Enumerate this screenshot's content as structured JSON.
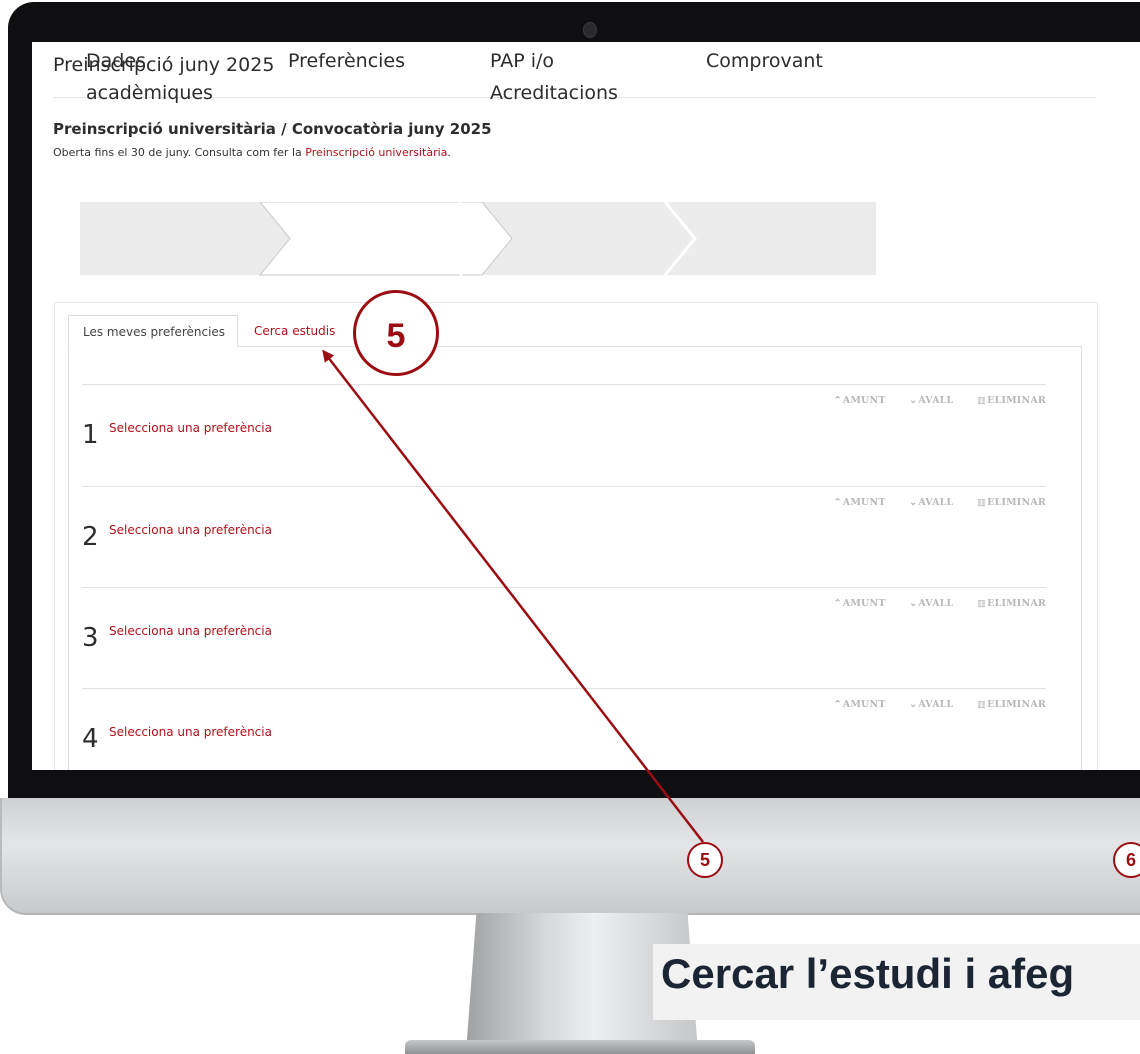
{
  "page": {
    "title": "Preinscripció juny 2025",
    "breadcrumb": "Preinscripció universitària / Convocatòria juny 2025",
    "note_prefix": "Oberta fins el 30 de juny. Consulta com fer la ",
    "note_link": "Preinscripció universitària",
    "note_suffix": "."
  },
  "steps": [
    {
      "line1": "Dades",
      "line2": "acadèmiques",
      "active": false
    },
    {
      "line1": "Preferències",
      "line2": "",
      "active": true
    },
    {
      "line1": "PAP i/o",
      "line2": "Acreditacions",
      "active": false
    },
    {
      "line1": "Comprovant",
      "line2": "",
      "active": false
    }
  ],
  "tabs": {
    "my_preferences": "Les meves preferències",
    "search": "Cerca estudis"
  },
  "actions": {
    "up": "AMUNT",
    "down": "AVALL",
    "delete": "ELIMINAR"
  },
  "preferences": [
    {
      "number": "1",
      "label": "Selecciona una preferència"
    },
    {
      "number": "2",
      "label": "Selecciona una preferència"
    },
    {
      "number": "3",
      "label": "Selecciona una preferència"
    },
    {
      "number": "4",
      "label": "Selecciona una preferència"
    }
  ],
  "annotations": {
    "big_badge": "5",
    "small_badge_5": "5",
    "small_badge_6": "6",
    "caption": "Cercar l’estudi i afeg"
  },
  "colors": {
    "accent": "#b0121b",
    "annotation": "#9b0d12",
    "steps_bg": "#ececec"
  }
}
